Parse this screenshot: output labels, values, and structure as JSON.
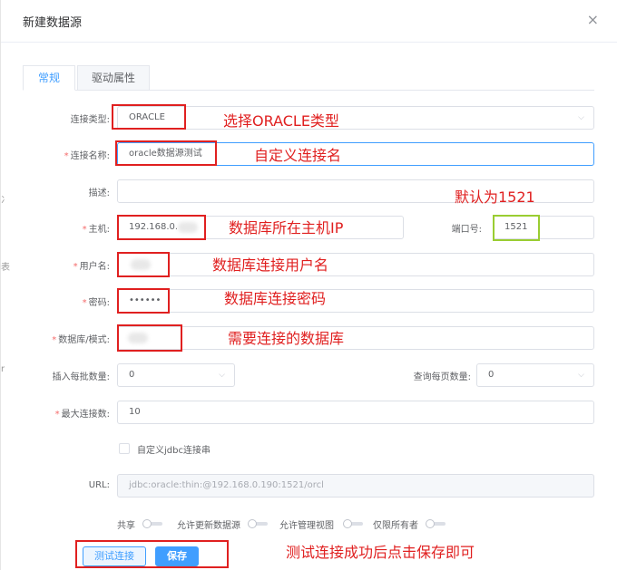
{
  "dialog": {
    "title": "新建数据源",
    "close_glyph": "×"
  },
  "tabs": [
    {
      "label": "常规"
    },
    {
      "label": "驱动属性"
    }
  ],
  "edge_marks": [
    "冫",
    "表",
    "r"
  ],
  "fields": {
    "type_label": "连接类型:",
    "type_value": "ORACLE",
    "name_label": "连接名称:",
    "name_value": "oracle数据源测试",
    "desc_label": "描述:",
    "host_label": "主机:",
    "host_value": "192.168.0.",
    "port_label": "端口号:",
    "port_value": "1521",
    "user_label": "用户名:",
    "pwd_label": "密码:",
    "pwd_value": "••••••",
    "db_label": "数据库/模式:",
    "insert_label": "插入每批数量:",
    "insert_value": "0",
    "query_label": "查询每页数量:",
    "query_value": "0",
    "maxconn_label": "最大连接数:",
    "maxconn_value": "10",
    "jdbc_checkbox_label": "自定义jdbc连接串",
    "url_label": "URL:",
    "url_value": "jdbc:oracle:thin:@192.168.0.190:1521/orcl",
    "required_mark": "*"
  },
  "switches": [
    {
      "label": "共享"
    },
    {
      "label": "允许更新数据源"
    },
    {
      "label": "允许管理视图"
    },
    {
      "label": "仅限所有者"
    }
  ],
  "buttons": {
    "test": "测试连接",
    "save": "保存"
  },
  "annotations": {
    "type": "选择ORACLE类型",
    "name": "自定义连接名",
    "port": "默认为1521",
    "host": "数据库所在主机IP",
    "user": "数据库连接用户名",
    "pwd": "数据库连接密码",
    "db": "需要连接的数据库",
    "save": "测试连接成功后点击保存即可"
  },
  "colors": {
    "accent": "#409eff",
    "annotation_red": "#e02020",
    "annotation_green": "#9acd32"
  }
}
